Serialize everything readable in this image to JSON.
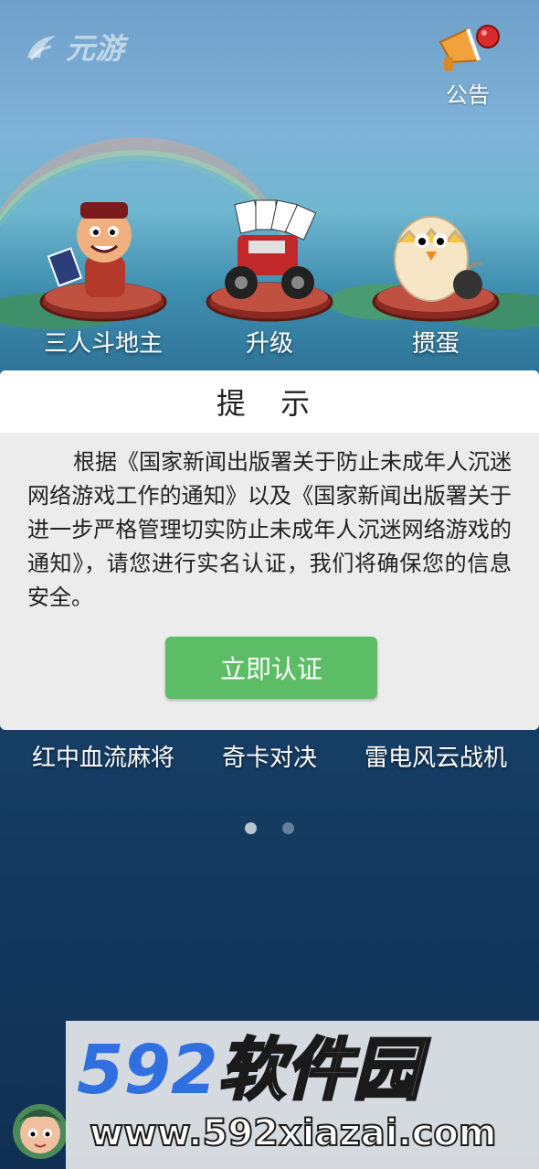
{
  "header": {
    "logo_text": "元游",
    "notice_label": "公告"
  },
  "games_row1": [
    {
      "label": "三人斗地主",
      "icon": "landlord-character-icon"
    },
    {
      "label": "升级",
      "icon": "tractor-cards-icon"
    },
    {
      "label": "掼蛋",
      "icon": "egg-chick-icon"
    }
  ],
  "dialog": {
    "title": "提 示",
    "body": "根据《国家新闻出版署关于防止未成年人沉迷网络游戏工作的通知》以及《国家新闻出版署关于进一步严格管理切实防止未成年人沉迷网络游戏的通知》，请您进行实名认证，我们将确保您的信息安全。",
    "confirm_label": "立即认证"
  },
  "games_row2": [
    {
      "label": "红中血流麻将"
    },
    {
      "label": "奇卡对决"
    },
    {
      "label": "雷电风云战机"
    }
  ],
  "pager": {
    "count": 2,
    "active": 0
  },
  "watermark": {
    "brand_number": "592",
    "brand_text": "软件园",
    "url": "www.592xiazai.com"
  },
  "colors": {
    "confirm_button": "#5cbd66",
    "dialog_bg": "#ececec",
    "watermark_blue": "#2f6fe0"
  }
}
